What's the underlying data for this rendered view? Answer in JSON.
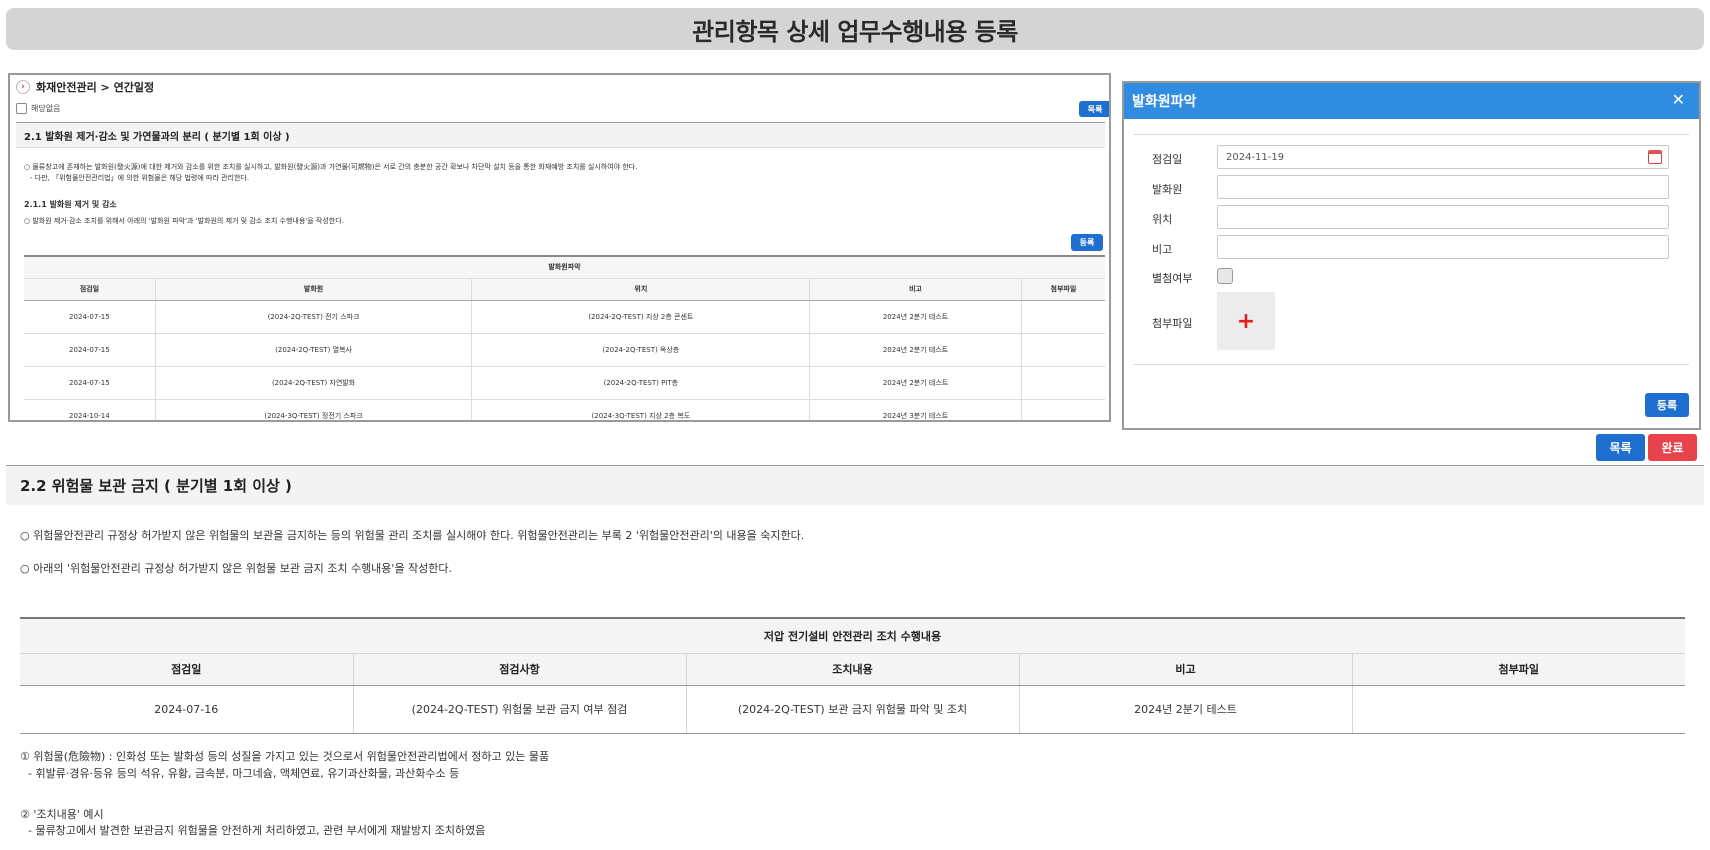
{
  "page": {
    "title": "관리항목 상세 업무수행내용 등록"
  },
  "mini": {
    "breadcrumb": "화재안전관리 > 연간일정",
    "not_applicable_label": "해당없음",
    "list_button": "목록",
    "section_title": "2.1 발화원 제거·감소 및 가연물과의 분리 ( 분기별 1회 이상 )",
    "para1": "○ 물류창고에 존재하는 발화원(發火源)에 대한 제거와 감소를 위한 조치를 실시하고, 발화원(發火源)과 가연물(可燃物)은 서로 간의 충분한 공간 확보나 차단막 설치 등을 통한 화재예방 조치를 실시하여야 한다.",
    "para2": "- 다만, 「위험물안전관리법」에 의한 위험물은 해당 법령에 따라 관리한다.",
    "subsection": "2.1.1 발화원 제거 및 감소",
    "para3": "○ 발화원 제거·감소 조치를 위해서 아래의 '발화원 파악'과 '발화원의 제거 및 감소 조치 수행내용'을 작성한다.",
    "register_button": "등록",
    "table": {
      "caption": "발화원파악",
      "headers": [
        "점검일",
        "발화원",
        "위치",
        "비고",
        "첨부파일"
      ],
      "rows": [
        [
          "2024-07-15",
          "(2024-2Q-TEST) 전기 스파크",
          "(2024-2Q-TEST) 지상 2층 콘센트",
          "2024년 2분기 테스트",
          ""
        ],
        [
          "2024-07-15",
          "(2024-2Q-TEST) 열복사",
          "(2024-2Q-TEST) 옥상층",
          "2024년 2분기 테스트",
          ""
        ],
        [
          "2024-07-15",
          "(2024-2Q-TEST) 자연발화",
          "(2024-2Q-TEST) PIT층",
          "2024년 2분기 테스트",
          ""
        ],
        [
          "2024-10-14",
          "(2024-3Q-TEST) 정전기 스파크",
          "(2024-3Q-TEST) 지상 2층 복도",
          "2024년 3분기 테스트",
          ""
        ]
      ]
    }
  },
  "modal": {
    "title": "발화원파악",
    "close_symbol": "✕",
    "fields": {
      "date_label": "점검일",
      "date_value": "2024-11-19",
      "source_label": "발화원",
      "source_value": "",
      "location_label": "위치",
      "location_value": "",
      "note_label": "비고",
      "note_value": "",
      "attach_flag_label": "별첨여부",
      "attach_label": "첨부파일",
      "upload_symbol": "+"
    },
    "register_button": "등록"
  },
  "actions": {
    "list": "목록",
    "complete": "완료"
  },
  "section22": {
    "title": "2.2 위험물 보관 금지 ( 분기별 1회 이상 )",
    "para1": "○ 위험물안전관리 규정상 허가받지 않은 위험물의 보관을 금지하는 등의 위험물 관리 조치를 실시해야 한다. 위험물안전관리는 부록 2 '위험물안전관리'의 내용을 숙지한다.",
    "para2": "○ 아래의 '위험물안전관리 규정상 허가받지 않은 위험물 보관 금지 조치 수행내용'을 작성한다.",
    "table": {
      "caption": "저압 전기설비 안전관리 조치 수행내용",
      "headers": [
        "점검일",
        "점검사항",
        "조치내용",
        "비고",
        "첨부파일"
      ],
      "rows": [
        [
          "2024-07-16",
          "(2024-2Q-TEST) 위험물 보관 금지 여부 점검",
          "(2024-2Q-TEST) 보관 금지 위험물 파악 및 조치",
          "2024년 2분기 테스트",
          ""
        ]
      ]
    },
    "note1_title": "① 위험물(危險物) : 인화성 또는 발화성 등의 성질을 가지고 있는 것으로서 위험물안전관리법에서 정하고 있는 물품",
    "note1_detail": "- 휘발류·경유·등유 등의 석유, 유황, 금속분, 마그네슘, 액체연료, 유기과산화물, 과산화수소 등",
    "note2_title": "② '조치내용' 예시",
    "note2_detail": "- 물류창고에서 발견한 보관금지 위험물을 안전하게 처리하였고, 관련 부서에게 재발방지 조치하였음"
  }
}
